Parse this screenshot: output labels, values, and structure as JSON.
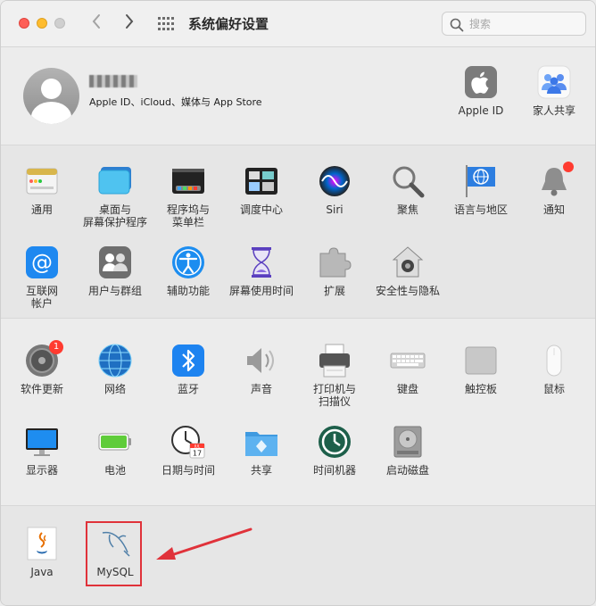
{
  "window": {
    "title": "系统偏好设置",
    "search_placeholder": "搜索"
  },
  "account": {
    "subtitle": "Apple ID、iCloud、媒体与 App Store",
    "items": [
      {
        "label": "Apple ID",
        "icon": "apple-id-icon"
      },
      {
        "label": "家人共享",
        "icon": "family-sharing-icon"
      }
    ]
  },
  "personal": [
    {
      "label": "通用",
      "icon": "general-icon"
    },
    {
      "label": "桌面与\n屏幕保护程序",
      "icon": "desktop-screensaver-icon"
    },
    {
      "label": "程序坞与\n菜单栏",
      "icon": "dock-menubar-icon"
    },
    {
      "label": "调度中心",
      "icon": "mission-control-icon"
    },
    {
      "label": "Siri",
      "icon": "siri-icon"
    },
    {
      "label": "聚焦",
      "icon": "spotlight-icon"
    },
    {
      "label": "语言与地区",
      "icon": "language-region-icon"
    },
    {
      "label": "通知",
      "icon": "notifications-icon"
    },
    {
      "label": "互联网\n帐户",
      "icon": "internet-accounts-icon"
    },
    {
      "label": "用户与群组",
      "icon": "users-groups-icon"
    },
    {
      "label": "辅助功能",
      "icon": "accessibility-icon"
    },
    {
      "label": "屏幕使用时间",
      "icon": "screen-time-icon"
    },
    {
      "label": "扩展",
      "icon": "extensions-icon"
    },
    {
      "label": "安全性与隐私",
      "icon": "security-privacy-icon"
    }
  ],
  "hardware": [
    {
      "label": "软件更新",
      "icon": "software-update-icon",
      "badge": "1"
    },
    {
      "label": "网络",
      "icon": "network-icon"
    },
    {
      "label": "蓝牙",
      "icon": "bluetooth-icon"
    },
    {
      "label": "声音",
      "icon": "sound-icon"
    },
    {
      "label": "打印机与\n扫描仪",
      "icon": "printers-scanners-icon"
    },
    {
      "label": "键盘",
      "icon": "keyboard-icon"
    },
    {
      "label": "触控板",
      "icon": "trackpad-icon"
    },
    {
      "label": "鼠标",
      "icon": "mouse-icon"
    },
    {
      "label": "显示器",
      "icon": "displays-icon"
    },
    {
      "label": "电池",
      "icon": "battery-icon"
    },
    {
      "label": "日期与时间",
      "icon": "date-time-icon"
    },
    {
      "label": "共享",
      "icon": "sharing-icon"
    },
    {
      "label": "时间机器",
      "icon": "time-machine-icon"
    },
    {
      "label": "启动磁盘",
      "icon": "startup-disk-icon"
    }
  ],
  "other": [
    {
      "label": "Java",
      "icon": "java-icon"
    },
    {
      "label": "MySQL",
      "icon": "mysql-icon"
    }
  ],
  "date_icon": {
    "month": "JUL",
    "day": "17"
  },
  "colors": {
    "highlight": "#e0323a",
    "badge": "#ff3b30"
  }
}
